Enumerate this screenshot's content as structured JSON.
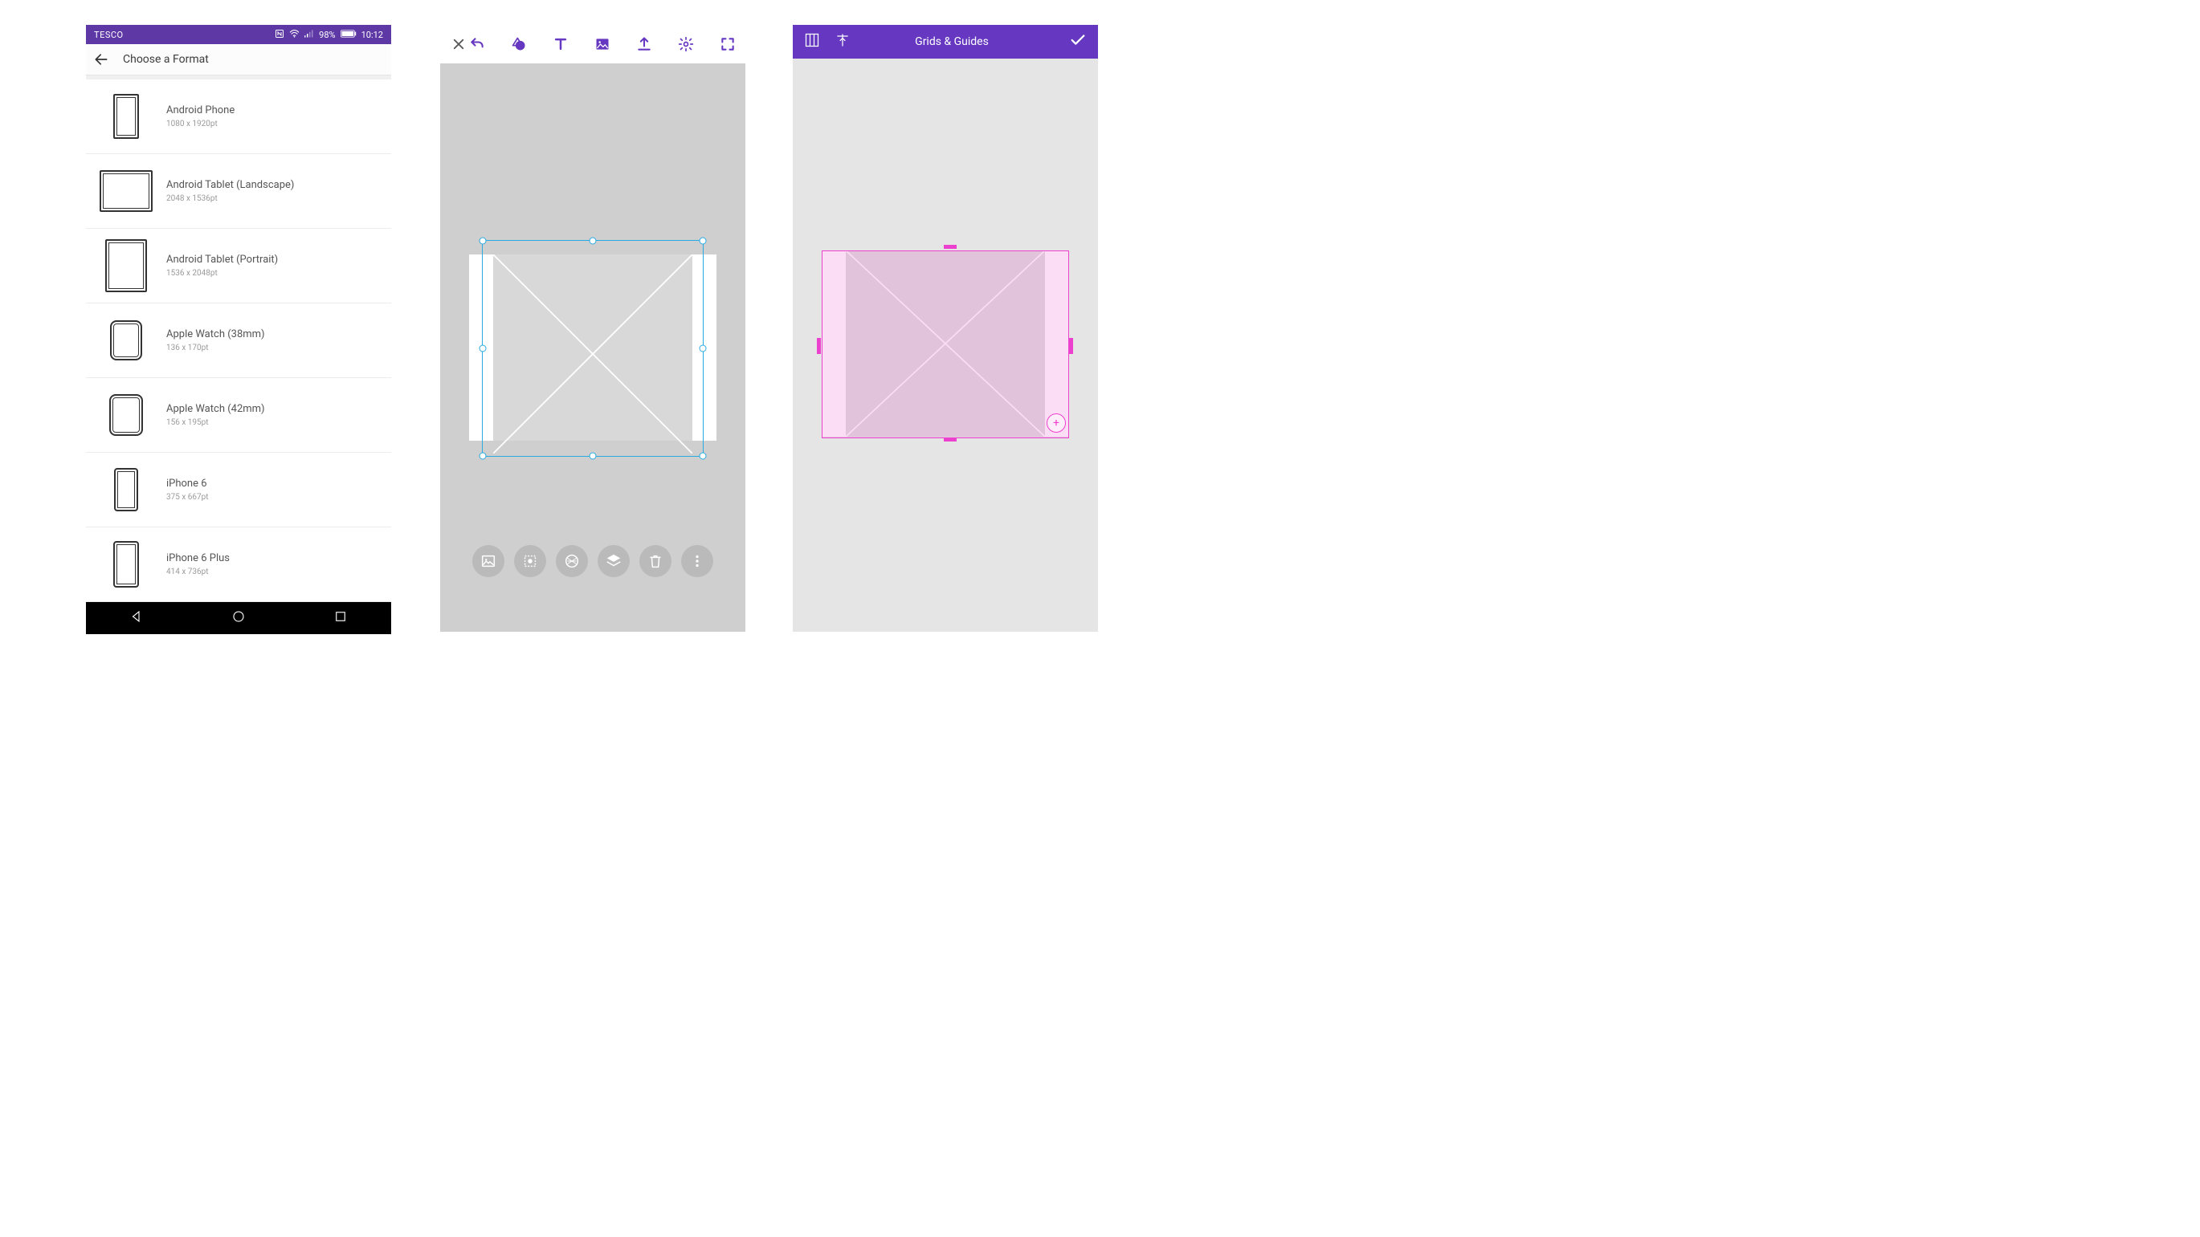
{
  "phone1": {
    "status": {
      "carrier": "TESCO",
      "battery": "98%",
      "time": "10:12"
    },
    "header": {
      "title": "Choose a Format"
    },
    "formats": [
      {
        "name": "Android Phone",
        "dim": "1080 x 1920pt",
        "w": 28,
        "h": 52,
        "radius": 2
      },
      {
        "name": "Android Tablet (Landscape)",
        "dim": "2048 x 1536pt",
        "w": 62,
        "h": 48,
        "radius": 2
      },
      {
        "name": "Android Tablet (Portrait)",
        "dim": "1536 x 2048pt",
        "w": 48,
        "h": 62,
        "radius": 2
      },
      {
        "name": "Apple Watch (38mm)",
        "dim": "136 x 170pt",
        "w": 36,
        "h": 46,
        "radius": 8
      },
      {
        "name": "Apple Watch (42mm)",
        "dim": "156 x 195pt",
        "w": 38,
        "h": 48,
        "radius": 8
      },
      {
        "name": "iPhone 6",
        "dim": "375 x 667pt",
        "w": 26,
        "h": 50,
        "radius": 4
      },
      {
        "name": "iPhone 6 Plus",
        "dim": "414 x 736pt",
        "w": 28,
        "h": 54,
        "radius": 4
      }
    ]
  },
  "phone2": {
    "top_tools": [
      "close",
      "undo",
      "shape",
      "text",
      "image",
      "upload",
      "settings",
      "fullscreen"
    ],
    "bottom_tools": [
      "image",
      "select-all",
      "pattern",
      "layers",
      "trash",
      "more"
    ]
  },
  "phone3": {
    "header": {
      "title": "Grids & Guides"
    },
    "left_tools": [
      "grid",
      "guides"
    ]
  },
  "colors": {
    "status_bar": "#5E39A6",
    "accent_purple": "#6638C1",
    "selection_blue": "#29ABE2",
    "guide_magenta": "#EC40CF"
  }
}
